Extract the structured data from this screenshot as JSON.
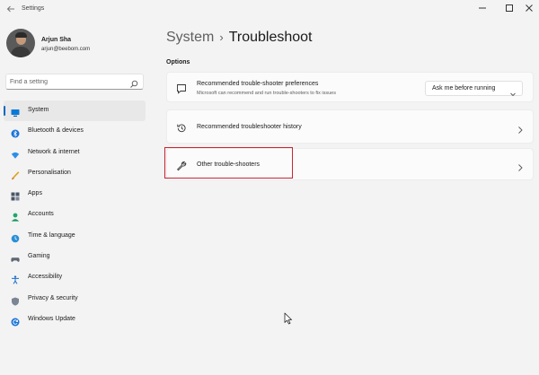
{
  "window": {
    "title": "Settings",
    "back_icon": "back-arrow-icon",
    "controls": {
      "minimize": "—",
      "maximize": "☐",
      "close": "✕"
    }
  },
  "profile": {
    "name": "Arjun Sha",
    "email": "arjun@beebom.com"
  },
  "search": {
    "placeholder": "Find a setting"
  },
  "nav": {
    "items": [
      {
        "label": "System",
        "icon": "monitor-icon",
        "selected": true
      },
      {
        "label": "Bluetooth & devices",
        "icon": "bluetooth-icon"
      },
      {
        "label": "Network & internet",
        "icon": "wifi-icon"
      },
      {
        "label": "Personalisation",
        "icon": "brush-icon"
      },
      {
        "label": "Apps",
        "icon": "apps-icon"
      },
      {
        "label": "Accounts",
        "icon": "person-icon"
      },
      {
        "label": "Time & language",
        "icon": "globe-clock-icon"
      },
      {
        "label": "Gaming",
        "icon": "gamepad-icon"
      },
      {
        "label": "Accessibility",
        "icon": "accessibility-icon"
      },
      {
        "label": "Privacy & security",
        "icon": "shield-icon"
      },
      {
        "label": "Windows Update",
        "icon": "update-icon"
      }
    ]
  },
  "breadcrumb": {
    "parent": "System",
    "separator": "›",
    "current": "Troubleshoot"
  },
  "section": {
    "label": "Options"
  },
  "cards": {
    "preferences": {
      "title": "Recommended trouble-shooter preferences",
      "description": "Microsoft can recommend and run trouble-shooters to fix issues",
      "dropdown_value": "Ask me before running"
    },
    "history": {
      "title": "Recommended troubleshooter history"
    },
    "other": {
      "title": "Other trouble-shooters"
    }
  },
  "colors": {
    "accent": "#0067c0",
    "highlight_box": "#c82530",
    "background": "#f3f3f3",
    "card": "#fbfbfb"
  }
}
